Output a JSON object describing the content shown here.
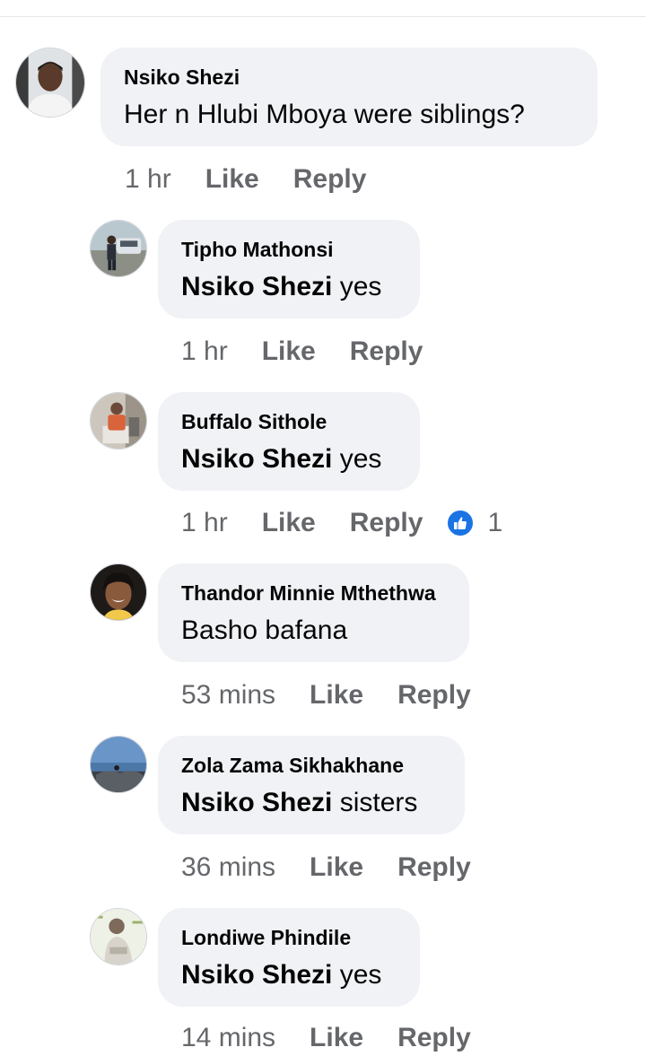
{
  "comments": [
    {
      "author": "Nsiko Shezi",
      "mention": "",
      "text": "Her n Hlubi Mboya were siblings?",
      "time": "1 hr",
      "like_label": "Like",
      "reply_label": "Reply"
    },
    {
      "author": "Tipho Mathonsi",
      "mention": "Nsiko Shezi",
      "text": " yes",
      "time": "1 hr",
      "like_label": "Like",
      "reply_label": "Reply"
    },
    {
      "author": "Buffalo Sithole",
      "mention": "Nsiko Shezi",
      "text": " yes",
      "time": "1 hr",
      "like_label": "Like",
      "reply_label": "Reply",
      "reaction_count": "1",
      "reaction_icon": "thumbs-up-icon"
    },
    {
      "author": "Thandor Minnie Mthethwa",
      "mention": "",
      "text": "Basho bafana",
      "time": "53 mins",
      "like_label": "Like",
      "reply_label": "Reply"
    },
    {
      "author": "Zola Zama Sikhakhane",
      "mention": "Nsiko Shezi",
      "text": " sisters",
      "time": "36 mins",
      "like_label": "Like",
      "reply_label": "Reply"
    },
    {
      "author": "Londiwe Phindile",
      "mention": "Nsiko Shezi",
      "text": " yes",
      "time": "14 mins",
      "like_label": "Like",
      "reply_label": "Reply"
    }
  ],
  "colors": {
    "bubble": "#f0f2f5",
    "meta_text": "#65676b",
    "reaction_blue": "#1b74e4"
  }
}
